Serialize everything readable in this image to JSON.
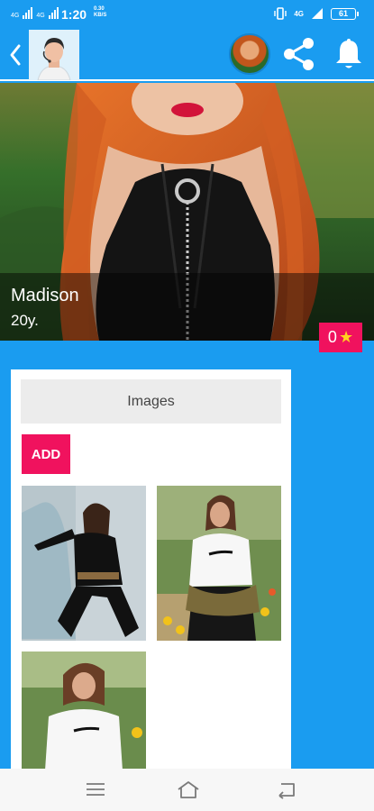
{
  "status_bar": {
    "network_1": "4G",
    "network_2": "4G",
    "time": "1:20",
    "speed": "0.30\nKB/S",
    "net_right": "4G",
    "battery": "61"
  },
  "profile": {
    "name": "Madison",
    "age": "20y.",
    "rating_count": "0",
    "rating_star": "★"
  },
  "images_section": {
    "tab_label": "Images",
    "add_label": "ADD"
  },
  "colors": {
    "primary": "#1a9cf0",
    "accent": "#f0125e",
    "star": "#ffd21f"
  },
  "icons": [
    "back-icon",
    "share-icon",
    "bell-icon",
    "menu-icon",
    "home-icon",
    "return-icon"
  ]
}
